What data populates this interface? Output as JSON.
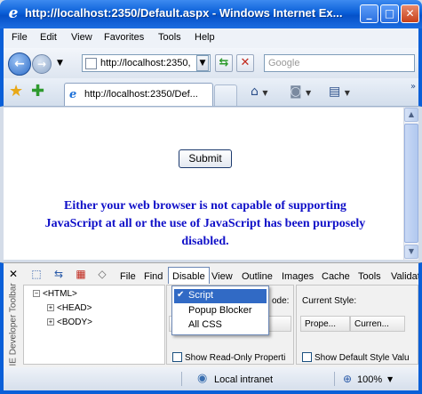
{
  "window": {
    "title": "http://localhost:2350/Default.aspx - Windows Internet Ex...",
    "minimize": "_",
    "maximize": "□",
    "close": "✕"
  },
  "menu": [
    "File",
    "Edit",
    "View",
    "Favorites",
    "Tools",
    "Help"
  ],
  "nav": {
    "address": "http://localhost:2350,",
    "search_placeholder": "Google"
  },
  "tab": {
    "label": "http://localhost:2350/Def..."
  },
  "page": {
    "submit_label": "Submit",
    "notice": "Either your web browser is not capable of supporting JavaScript at all or the use of JavaScript has been purposely disabled.",
    "notice_color": "#1010c8"
  },
  "devtoolbar": {
    "side_label": "IE Developer Toolbar",
    "menus": [
      "File",
      "Find",
      "Disable",
      "View",
      "Outline",
      "Images",
      "Cache",
      "Tools",
      "Validat"
    ],
    "active_menu": "Disable",
    "tree": [
      "<HTML>",
      "<HEAD>",
      "<BODY>"
    ],
    "attr_panel": {
      "header_fragment": "ode:",
      "checkbox_label": "Show Read-Only Properti"
    },
    "style_panel": {
      "header": "Current Style:",
      "col_property": "Prope...",
      "col_current": "Curren...",
      "checkbox_label": "Show Default Style Valu"
    },
    "dropdown": [
      {
        "label": "Script",
        "checked": true
      },
      {
        "label": "Popup Blocker",
        "checked": false
      },
      {
        "label": "All CSS",
        "checked": false
      }
    ]
  },
  "status": {
    "zone": "Local intranet",
    "zoom": "100%"
  },
  "colors": {
    "titlebar": "#0a5fd8",
    "selection": "#316ac5"
  }
}
